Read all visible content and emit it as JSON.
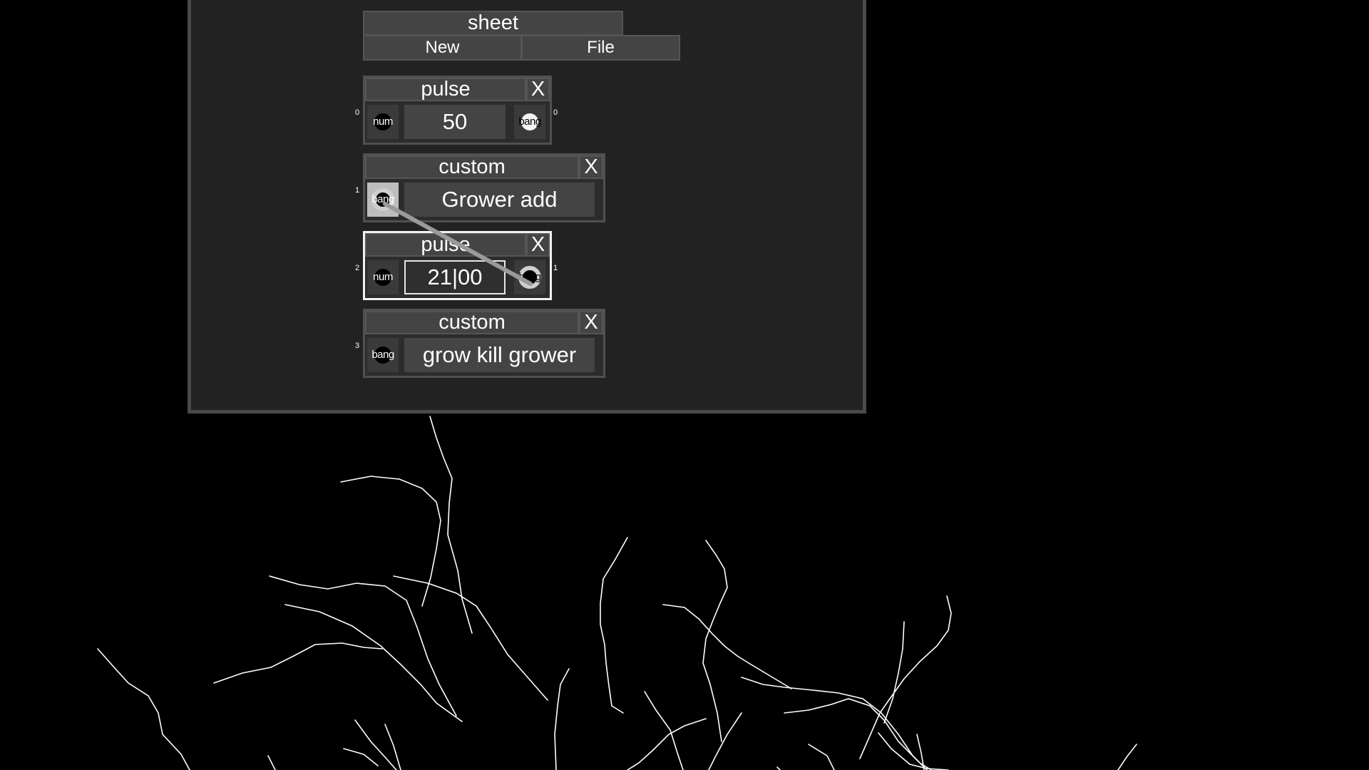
{
  "sheet": {
    "title": "sheet",
    "new_label": "New",
    "file_label": "File"
  },
  "nodes": [
    {
      "index": "0",
      "type": "pulse",
      "close": "X",
      "left_label": "num",
      "value": "50",
      "right_label": "bang",
      "right_index": "0"
    },
    {
      "index": "1",
      "type": "custom",
      "close": "X",
      "left_label": "bang",
      "command": "Grower add"
    },
    {
      "index": "2",
      "type": "pulse",
      "close": "X",
      "left_label": "num",
      "value": "21|00",
      "right_label": "bang",
      "right_index": "1"
    },
    {
      "index": "3",
      "type": "custom",
      "close": "X",
      "left_label": "bang",
      "command": "grow kill grower"
    }
  ],
  "colors": {
    "background": "#000000",
    "panel": "#222222",
    "node_header": "#444444",
    "selected_border": "#f2f2f2",
    "growth_lines": "#ffffff"
  }
}
